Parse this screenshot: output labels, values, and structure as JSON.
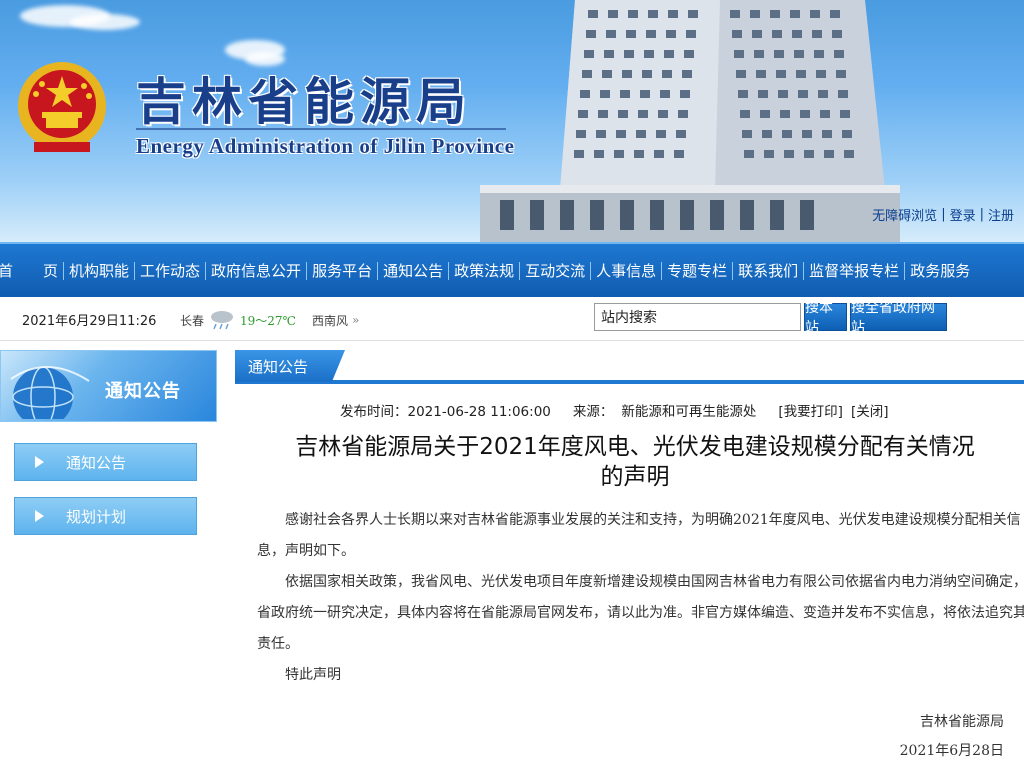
{
  "header": {
    "title": "吉林省能源局",
    "subtitle": "Energy Administration of Jilin Province",
    "links": [
      "无障碍浏览",
      "登录",
      "注册"
    ]
  },
  "nav": {
    "items": [
      "首　　页",
      "机构职能",
      "工作动态",
      "政府信息公开",
      "服务平台",
      "通知公告",
      "政策法规",
      "互动交流",
      "人事信息",
      "专题专栏",
      "联系我们",
      "监督举报专栏",
      "政务服务"
    ]
  },
  "infobar": {
    "datetime": "2021年6月29日11:26",
    "city": "长春",
    "temperature": "19～27℃",
    "wind": "西南风",
    "more": "»"
  },
  "search": {
    "value": "站内搜索",
    "site_button": "搜本站",
    "gov_button": "搜全省政府网站"
  },
  "sidebar": {
    "title": "通知公告",
    "items": [
      "通知公告",
      "规划计划"
    ]
  },
  "content": {
    "tab_label": "通知公告",
    "meta": {
      "publish_label": "发布时间：2021-06-28 11:06:00",
      "source_label": "来源：",
      "source_value": "新能源和可再生能源处",
      "print_link": "[我要打印]",
      "close_link": "[关闭]"
    },
    "title_line1": "吉林省能源局关于2021年度风电、光伏发电建设规模分配有关情况",
    "title_line2": "的声明",
    "paragraphs": [
      "感谢社会各界人士长期以来对吉林省能源事业发展的关注和支持，为明确2021年度风电、光伏发电建设规模分配相关信息，声明如下。",
      "依据国家相关政策，我省风电、光伏发电项目年度新增建设规模由国网吉林省电力有限公司依据省内电力消纳空间确定，省政府统一研究决定，具体内容将在省能源局官网发布，请以此为准。非官方媒体编造、变造并发布不实信息，将依法追究其责任。",
      "特此声明"
    ],
    "signature": "吉林省能源局",
    "sign_date": "2021年6月28日"
  },
  "colors": {
    "nav_blue": "#0f5cb0",
    "title_blue": "#1a3f8a",
    "temp_green": "#2b9b2b"
  }
}
